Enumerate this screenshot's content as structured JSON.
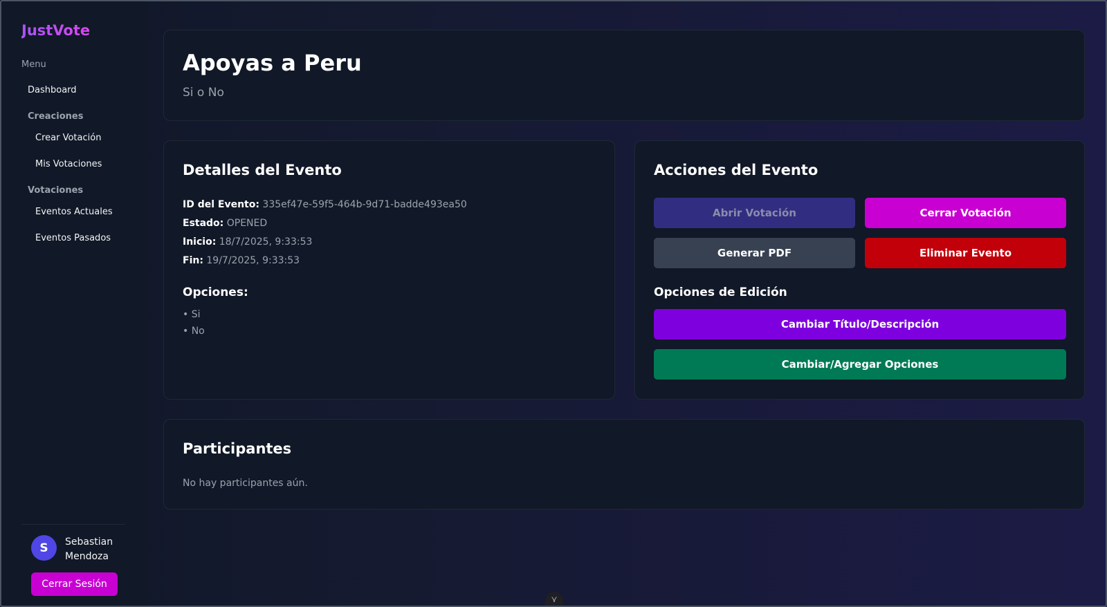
{
  "app": {
    "logo": "JustVote"
  },
  "sidebar": {
    "menu_label": "Menu",
    "dashboard": "Dashboard",
    "group_creations": "Creaciones",
    "create_vote": "Crear Votación",
    "my_votes": "Mis Votaciones",
    "group_votes": "Votaciones",
    "current_events": "Eventos Actuales",
    "past_events": "Eventos Pasados"
  },
  "user": {
    "initial": "S",
    "name": "Sebastian Mendoza",
    "logout": "Cerrar Sesión"
  },
  "event": {
    "title": "Apoyas a Peru",
    "description": "Si o No"
  },
  "details": {
    "heading": "Detalles del Evento",
    "id_label": "ID del Evento:",
    "id_value": "335ef47e-59f5-464b-9d71-badde493ea50",
    "status_label": "Estado:",
    "status_value": "OPENED",
    "start_label": "Inicio:",
    "start_value": "18/7/2025, 9:33:53",
    "end_label": "Fin:",
    "end_value": "19/7/2025, 9:33:53",
    "options_heading": "Opciones:",
    "options": [
      "• Si",
      "• No"
    ]
  },
  "actions": {
    "heading": "Acciones del Evento",
    "open_vote": "Abrir Votación",
    "close_vote": "Cerrar Votación",
    "generate_pdf": "Generar PDF",
    "delete_event": "Eliminar Evento",
    "edit_heading": "Opciones de Edición",
    "change_title": "Cambiar Título/Descripción",
    "change_options": "Cambiar/Agregar Opciones"
  },
  "participants": {
    "heading": "Participantes",
    "empty": "No hay participantes aún."
  },
  "scroll": {
    "icon": "chevron-down-icon",
    "glyph": "⋎"
  }
}
